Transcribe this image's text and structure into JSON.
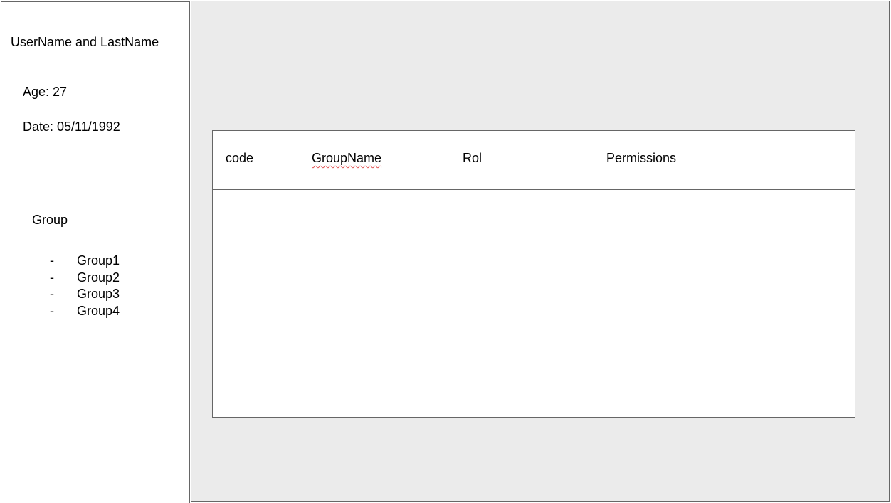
{
  "profile": {
    "name": "UserName and LastName",
    "age": "Age: 27",
    "date": "Date: 05/11/1992"
  },
  "groups": {
    "title": "Group",
    "bullet": "-",
    "items": [
      "Group1",
      "Group2",
      "Group3",
      "Group4"
    ]
  },
  "table": {
    "columns": [
      "code",
      "GroupName",
      "Rol",
      "Permissions"
    ]
  },
  "colors": {
    "border": "#666666",
    "main_background": "#ebebeb",
    "panel_background": "#ffffff",
    "spellcheck_underline": "#e05050"
  }
}
